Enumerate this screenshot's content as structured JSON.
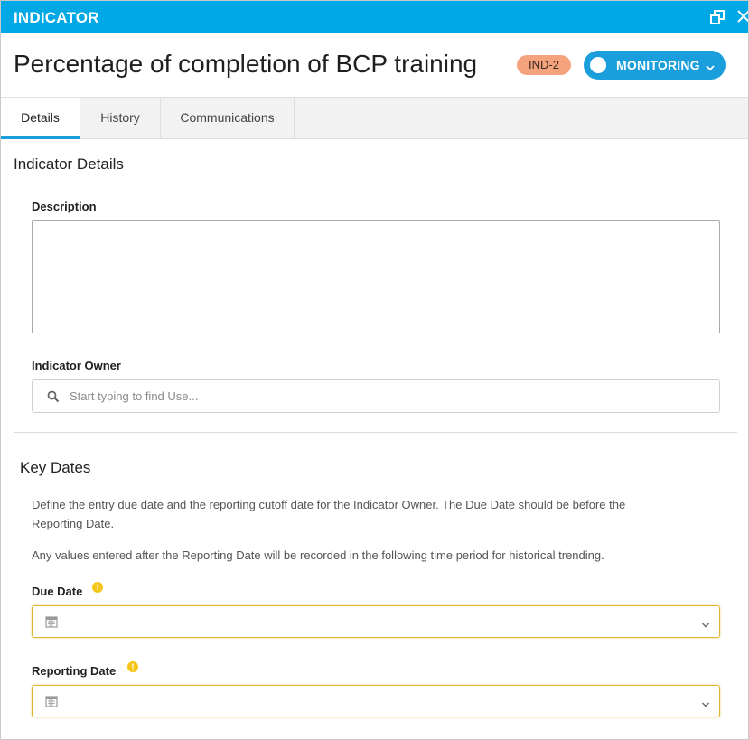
{
  "window": {
    "title": "INDICATOR"
  },
  "header": {
    "title": "Percentage of completion of BCP training",
    "badge": "IND-2",
    "status": "MONITORING"
  },
  "tabs": [
    {
      "label": "Details",
      "active": true
    },
    {
      "label": "History",
      "active": false
    },
    {
      "label": "Communications",
      "active": false
    }
  ],
  "indicator_details": {
    "section_title": "Indicator Details",
    "description_label": "Description",
    "description_value": "",
    "owner_label": "Indicator Owner",
    "owner_placeholder": "Start typing to find Use..."
  },
  "key_dates": {
    "section_title": "Key Dates",
    "paragraph1_line1": "Define the entry due date and the reporting cutoff date for the Indicator Owner. The Due Date should be before the",
    "paragraph1_line2": "Reporting Date.",
    "paragraph2": "Any values entered after the Reporting Date will be recorded in the following time period for historical trending.",
    "due_date_label": "Due Date",
    "due_date_value": "",
    "reporting_date_label": "Reporting Date",
    "reporting_date_value": ""
  },
  "colors": {
    "titlebar": "#00a8e6",
    "accent": "#1a9fdc",
    "badge": "#f5a37c",
    "warning": "#f5c518",
    "date_border": "#e6b52e"
  },
  "icons": [
    "restore-window-icon",
    "close-icon",
    "chevron-down-icon",
    "search-icon",
    "warning-icon",
    "calendar-icon"
  ]
}
